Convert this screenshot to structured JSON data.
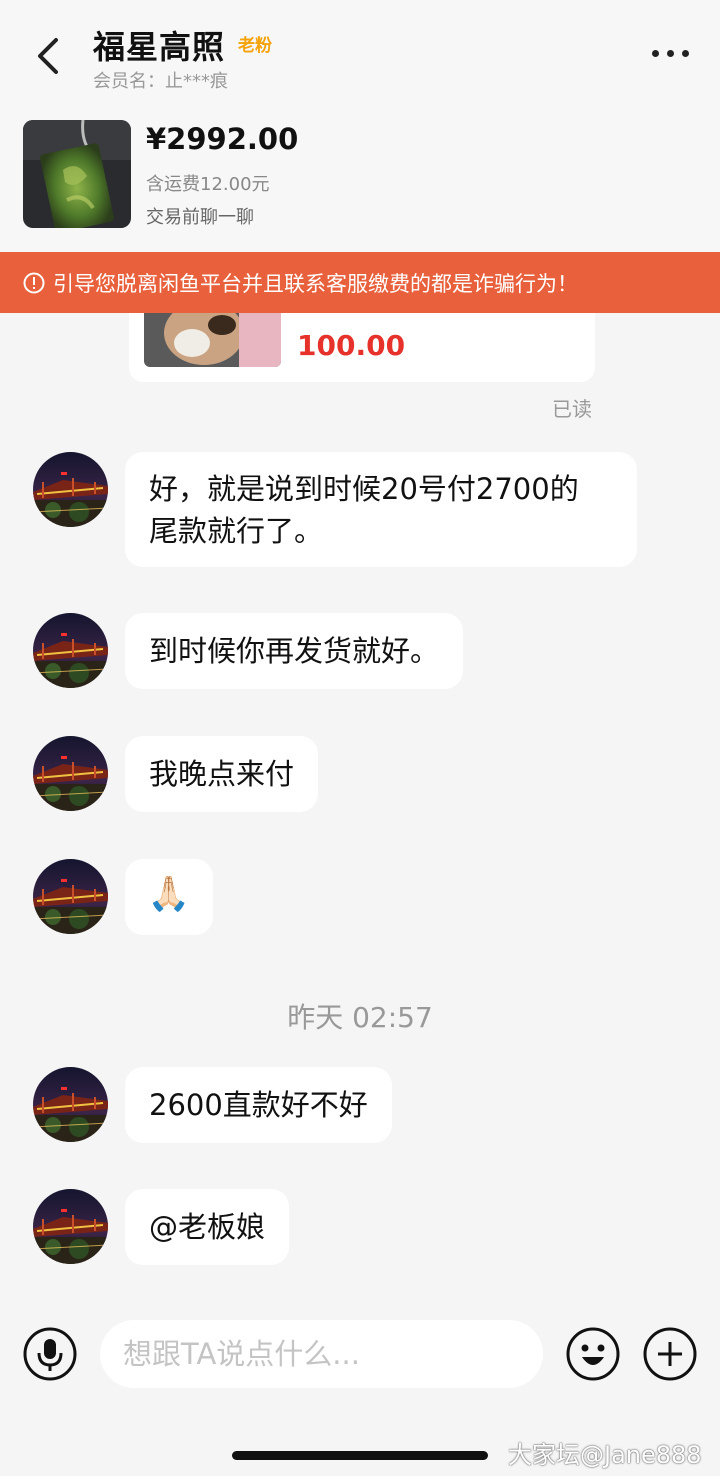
{
  "header": {
    "title": "福星高照",
    "badge": "老粉",
    "member": "会员名：止***痕",
    "back_icon": "chevron-left-icon",
    "more_icon": "more-dots-icon"
  },
  "product": {
    "price": "¥2992.00",
    "shipping": "含运费12.00元",
    "note": "交易前聊一聊",
    "image": "jade-pendant-image"
  },
  "warning": {
    "text": "引导您脱离闲鱼平台并且联系客服缴费的都是诈骗行为！",
    "icon": "alert-circle-icon",
    "bg_color": "#e8603c"
  },
  "chat": {
    "partial_card_value": "100.00",
    "read_status": "已读",
    "messages": [
      {
        "text_line1": "好，就是说到时候20号付2700的",
        "text_line2": "尾款就行了。"
      },
      {
        "text": "到时候你再发货就好。"
      },
      {
        "text": "我晚点来付"
      },
      {
        "emoji": "🙏🏻"
      },
      {
        "text": "2600直款好不好"
      },
      {
        "text": "@老板娘"
      }
    ],
    "timestamp": "昨天 02:57"
  },
  "input": {
    "placeholder": "想跟TA说点什么...",
    "mic_icon": "microphone-icon",
    "emoji_icon": "smiley-icon",
    "plus_icon": "plus-circle-icon"
  },
  "watermark": "大家坛@Jane888"
}
